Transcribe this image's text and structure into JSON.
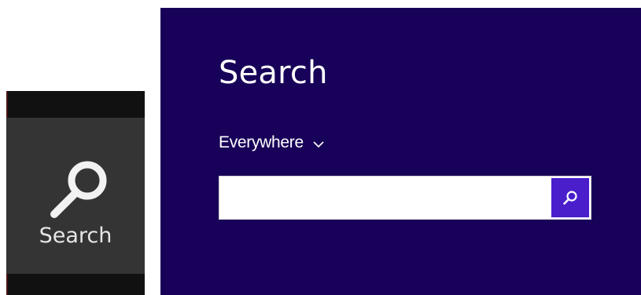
{
  "charm_bar": {
    "search_label": "Search",
    "icon": "search-icon"
  },
  "search_pane": {
    "title": "Search",
    "scope": {
      "selected": "Everywhere",
      "icon": "chevron-down-icon"
    },
    "input": {
      "value": "",
      "placeholder": ""
    },
    "submit_icon": "search-icon"
  },
  "colors": {
    "pane_background": "#180158",
    "submit_button": "#4a1ecb",
    "charm_bar_background": "#111111",
    "charm_item_background": "#343434"
  }
}
